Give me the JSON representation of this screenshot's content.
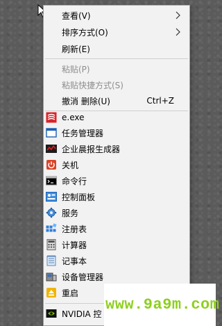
{
  "menu": {
    "items": [
      {
        "label": "查看(V)",
        "submenu": true,
        "icon": "none"
      },
      {
        "label": "排序方式(O)",
        "submenu": true,
        "icon": "none"
      },
      {
        "label": "刷新(E)",
        "icon": "none"
      },
      {
        "label": "粘贴(P)",
        "disabled": true,
        "icon": "none"
      },
      {
        "label": "粘贴快捷方式(S)",
        "disabled": true,
        "icon": "none"
      },
      {
        "label": "撤消 删除(U)",
        "shortcut": "Ctrl+Z",
        "icon": "none"
      },
      {
        "label": "e.exe",
        "icon": "app-icon"
      },
      {
        "label": "任务管理器",
        "icon": "window-icon"
      },
      {
        "label": "企业晨报生成器",
        "icon": "report-icon"
      },
      {
        "label": "关机",
        "icon": "power-icon"
      },
      {
        "label": "命令行",
        "icon": "console-icon"
      },
      {
        "label": "控制面板",
        "icon": "control-panel-icon"
      },
      {
        "label": "服务",
        "icon": "gear-icon"
      },
      {
        "label": "注册表",
        "icon": "registry-icon"
      },
      {
        "label": "计算器",
        "icon": "calculator-icon"
      },
      {
        "label": "记事本",
        "icon": "notepad-icon"
      },
      {
        "label": "设备管理器",
        "icon": "device-manager-icon"
      },
      {
        "label": "重启",
        "icon": "restart-icon"
      },
      {
        "label": "NVIDIA 控",
        "icon": "nvidia-icon"
      }
    ]
  },
  "watermark": {
    "text": "www.9a9m.com",
    "color": "#8ecf1f"
  }
}
